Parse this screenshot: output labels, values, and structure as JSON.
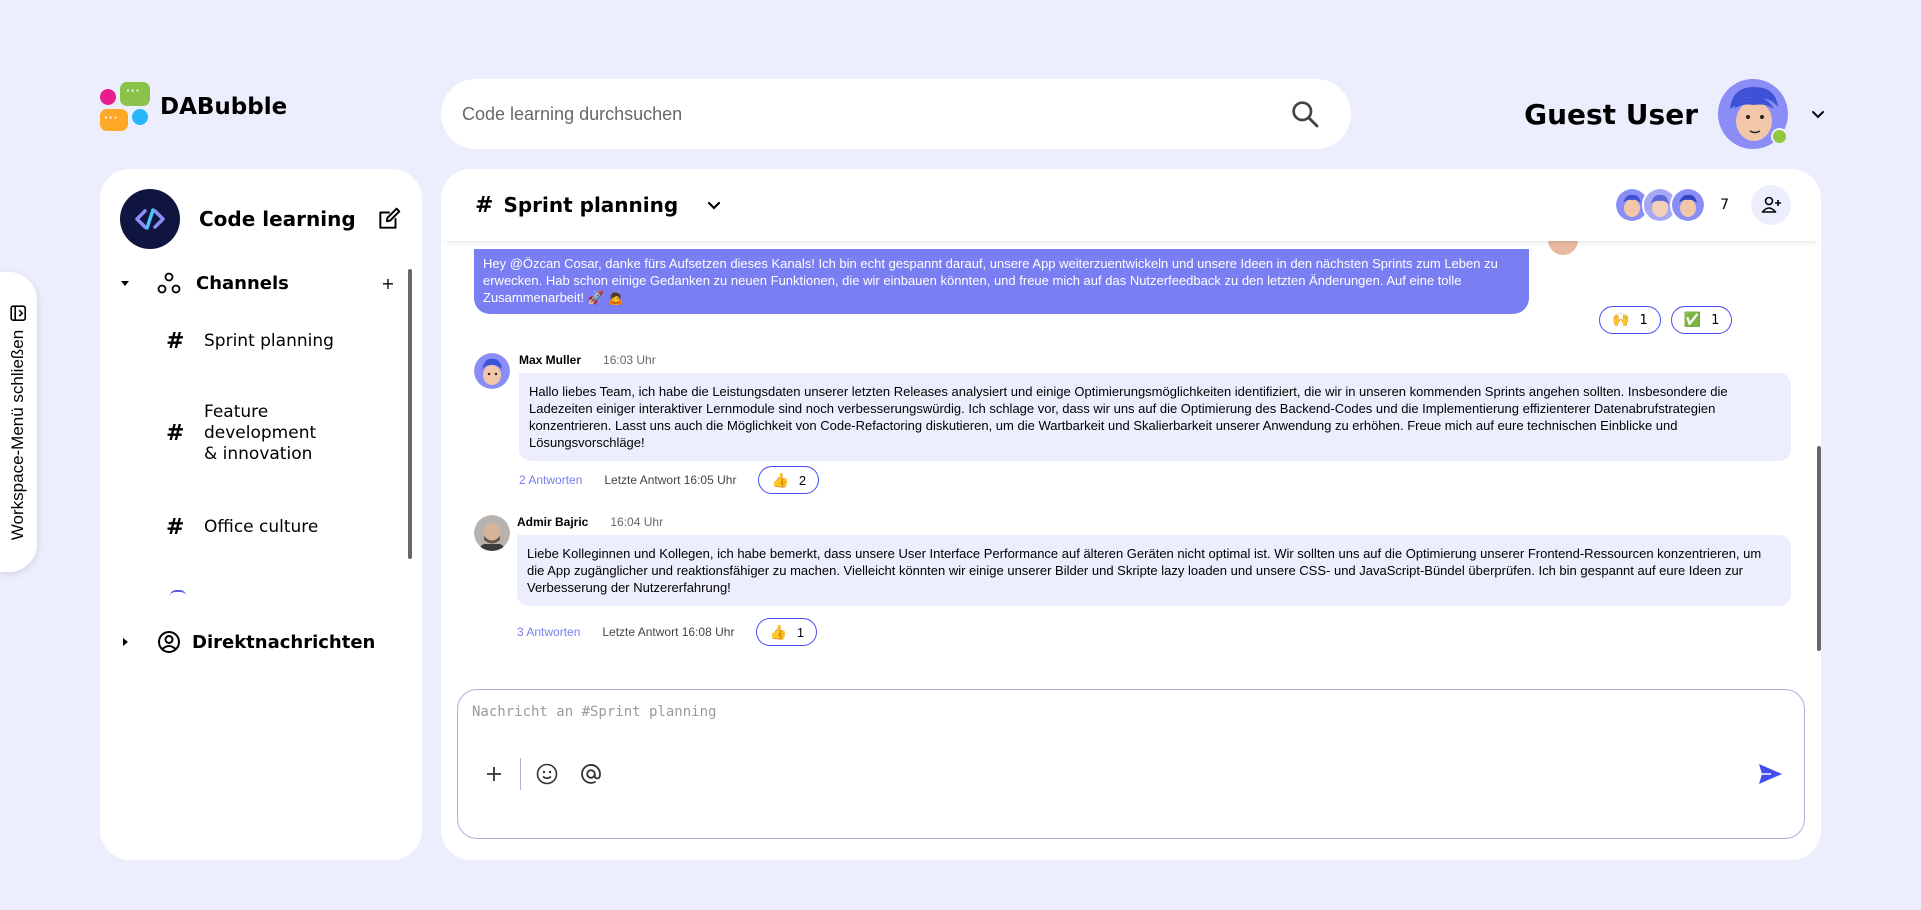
{
  "app": {
    "name": "DABubble"
  },
  "search": {
    "placeholder": "Code learning durchsuchen"
  },
  "user": {
    "name": "Guest User",
    "status_color": "#92c83e"
  },
  "workspace_toggle": {
    "label": "Workspace-Menü schließen"
  },
  "sidebar": {
    "workspace_title": "Code learning",
    "channels_label": "Channels",
    "add_channel": "+",
    "channels": [
      {
        "hash": "#",
        "label": "Sprint planning"
      },
      {
        "hash": "#",
        "label": "Feature development & innovation"
      },
      {
        "hash": "#",
        "label": "Office culture"
      }
    ],
    "direct_messages_label": "Direktnachrichten"
  },
  "channel": {
    "hash": "#",
    "title": "Sprint planning",
    "member_count": "7"
  },
  "messages": {
    "own": {
      "text": "Hey @Özcan Cosar, danke fürs Aufsetzen dieses Kanals! Ich bin echt gespannt darauf, unsere App weiterzuentwickeln und unsere Ideen in den nächsten Sprints zum Leben zu erwecken. Hab schon einige Gedanken zu neuen Funktionen, die wir einbauen könnten, und freue mich auf das Nutzerfeedback zu den letzten Änderungen. Auf eine tolle Zusammenarbeit! 🚀 🙇",
      "reactions": [
        {
          "emoji": "🙌",
          "count": "1"
        },
        {
          "emoji": "✅",
          "count": "1"
        }
      ]
    },
    "list": [
      {
        "author": "Max Muller",
        "time": "16:03 Uhr",
        "text": "Hallo liebes Team, ich habe die Leistungsdaten unserer letzten Releases analysiert und einige Optimierungsmöglichkeiten identifiziert, die wir in unseren kommenden Sprints angehen sollten. Insbesondere die Ladezeiten einiger interaktiver Lernmodule sind noch verbesserungswürdig. Ich schlage vor, dass wir uns auf die Optimierung des Backend-Codes und die Implementierung effizienterer Datenabrufstrategien konzentrieren. Lasst uns auch die Möglichkeit von Code-Refactoring diskutieren, um die Wartbarkeit und Skalierbarkeit unserer Anwendung zu erhöhen. Freue mich auf eure technischen Einblicke und Lösungsvorschläge!",
        "replies": "2 Antworten",
        "last_reply": "Letzte Antwort 16:05 Uhr",
        "reaction": {
          "emoji": "👍",
          "count": "2"
        }
      },
      {
        "author": "Admir Bajric",
        "time": "16:04 Uhr",
        "text": "Liebe Kolleginnen und Kollegen, ich habe bemerkt, dass unsere User Interface Performance auf älteren Geräten nicht optimal ist. Wir sollten uns auf die Optimierung unserer Frontend-Ressourcen konzentrieren, um die App zugänglicher und reaktionsfähiger zu machen. Vielleicht könnten wir einige unserer Bilder und Skripte lazy loaden und unsere CSS- und JavaScript-Bündel überprüfen. Ich bin gespannt auf eure Ideen zur Verbesserung der Nutzererfahrung!",
        "replies": "3 Antworten",
        "last_reply": "Letzte Antwort 16:08 Uhr",
        "reaction": {
          "emoji": "👍",
          "count": "1"
        }
      }
    ]
  },
  "composer": {
    "placeholder": "Nachricht an #Sprint planning"
  },
  "colors": {
    "background": "#eceefe",
    "accent": "#444df2",
    "own_bubble": "#797ef3",
    "link": "#797ef3"
  }
}
